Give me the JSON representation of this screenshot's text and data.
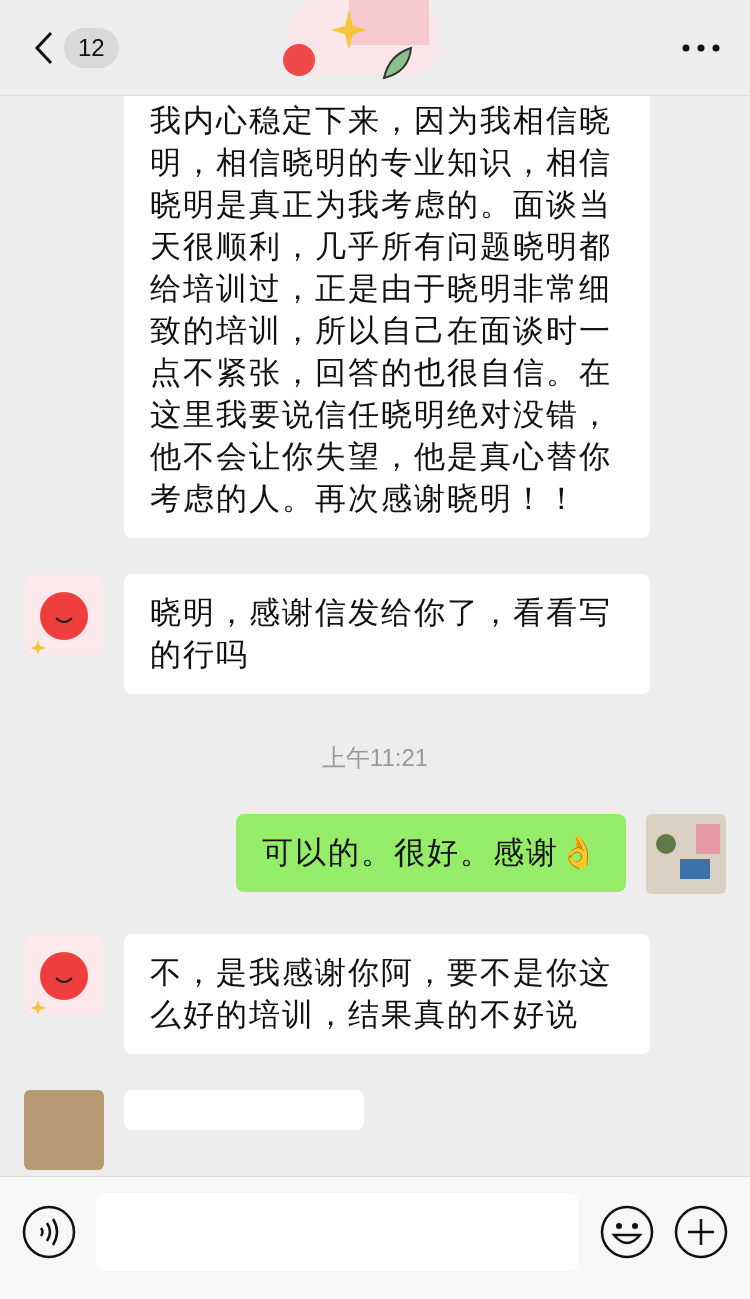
{
  "header": {
    "unread_count": "12"
  },
  "messages": [
    {
      "kind": "continued",
      "text": "我内心稳定下来，因为我相信晓明，相信晓明的专业知识，相信晓明是真正为我考虑的。面谈当天很顺利，几乎所有问题晓明都给培训过，正是由于晓明非常细致的培训，所以自己在面谈时一点不紧张，回答的也很自信。在这里我要说信任晓明绝对没错，他不会让你失望，他是真心替你考虑的人。再次感谢晓明！！"
    },
    {
      "kind": "incoming",
      "text": "晓明，感谢信发给你了，看看写的行吗"
    },
    {
      "kind": "time",
      "text": "上午11:21"
    },
    {
      "kind": "outgoing",
      "text": "可以的。很好。感谢👌"
    },
    {
      "kind": "incoming",
      "text": "不，是我感谢你阿，要不是你这么好的培训，结果真的不好说"
    },
    {
      "kind": "partial"
    }
  ]
}
